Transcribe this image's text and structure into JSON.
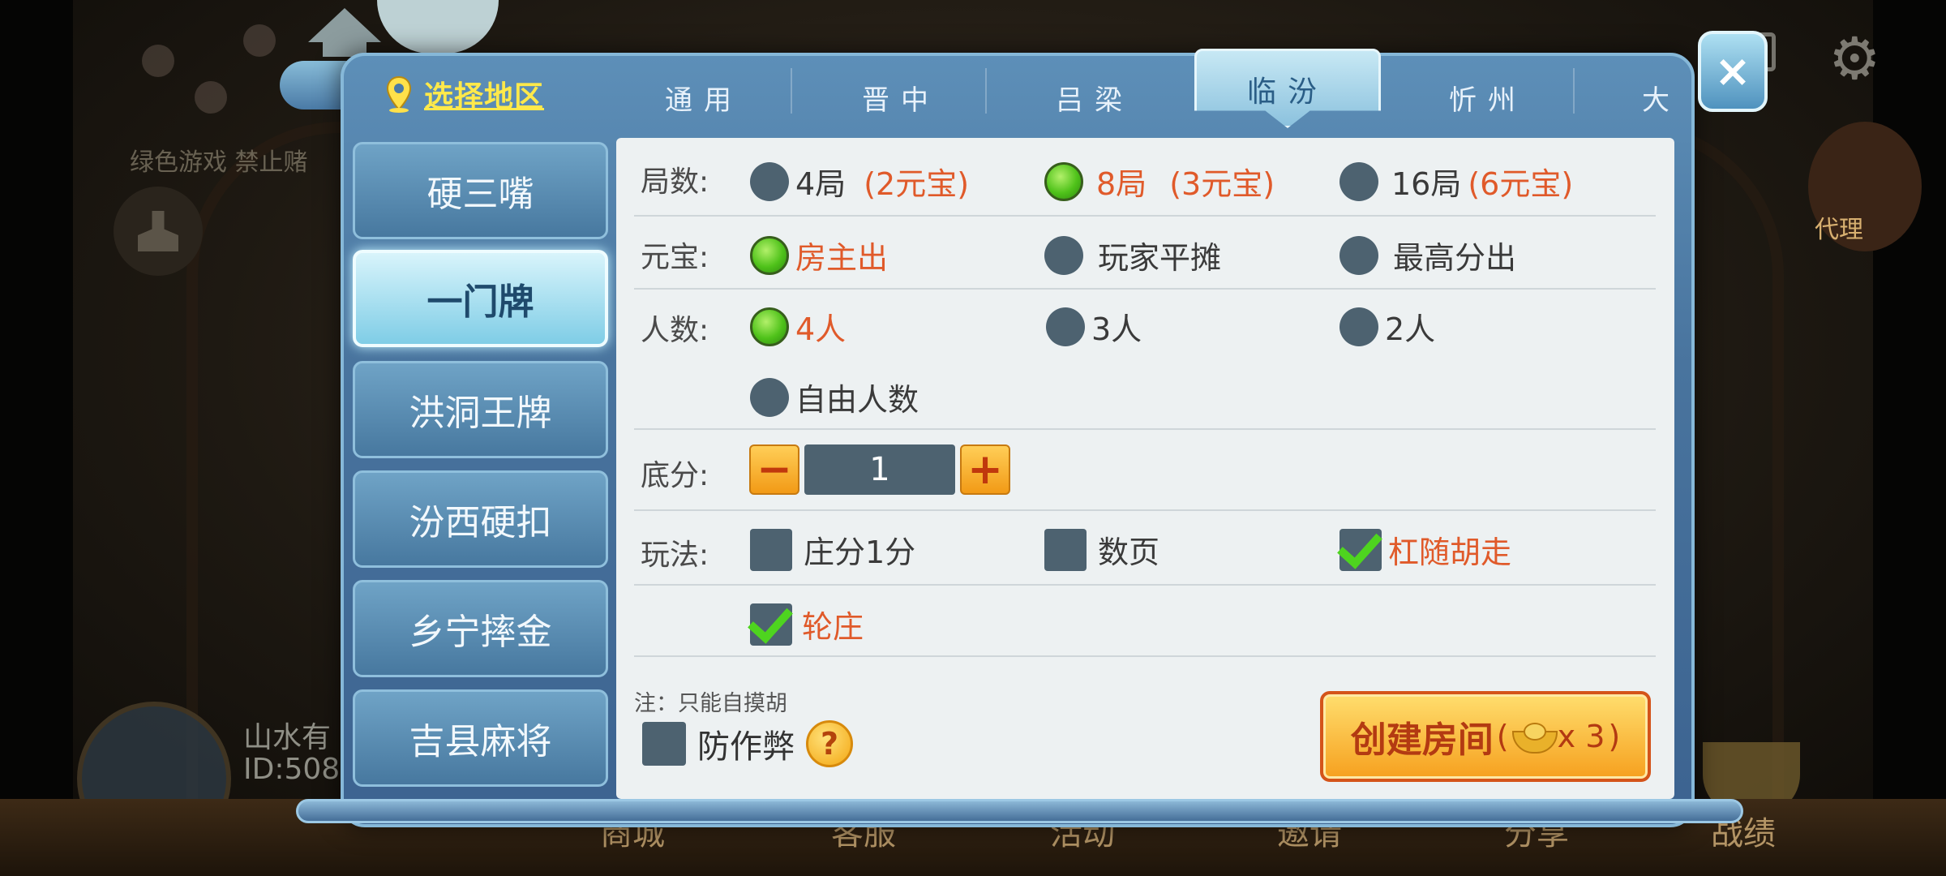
{
  "background": {
    "notice": "绿色游戏 禁止赌",
    "username": "山水有",
    "user_id": "ID:508",
    "agent_label": "代理",
    "bottom_nav": [
      "商城",
      "客服",
      "活动",
      "邀请",
      "分享",
      "战绩"
    ]
  },
  "dialog": {
    "region_label": "选择地区",
    "tabs": [
      "通用",
      "晋中",
      "吕梁",
      "临汾",
      "忻州",
      "大"
    ],
    "active_tab": "临汾",
    "close_label": "×",
    "games": [
      "硬三嘴",
      "一门牌",
      "洪洞王牌",
      "汾西硬扣",
      "乡宁摔金",
      "吉县麻将"
    ],
    "active_game": "一门牌",
    "rounds": {
      "label": "局数:",
      "options": [
        {
          "text": "4局",
          "extra": "(2元宝)",
          "selected": false
        },
        {
          "text": "8局",
          "extra": "(3元宝)",
          "selected": true
        },
        {
          "text": "16局",
          "extra": "(6元宝)",
          "selected": false
        }
      ]
    },
    "ingot": {
      "label": "元宝:",
      "options": [
        {
          "text": "房主出",
          "selected": true
        },
        {
          "text": "玩家平摊",
          "selected": false
        },
        {
          "text": "最高分出",
          "selected": false
        }
      ]
    },
    "players": {
      "label": "人数:",
      "options": [
        {
          "text": "4人",
          "selected": true
        },
        {
          "text": "3人",
          "selected": false
        },
        {
          "text": "2人",
          "selected": false
        },
        {
          "text": "自由人数",
          "selected": false
        }
      ]
    },
    "base_score": {
      "label": "底分:",
      "minus": "−",
      "plus": "+",
      "value": "1"
    },
    "rules": {
      "label": "玩法:",
      "options": [
        {
          "text": "庄分1分",
          "checked": false
        },
        {
          "text": "数页",
          "checked": false
        },
        {
          "text": "杠随胡走",
          "checked": true
        },
        {
          "text": "轮庄",
          "checked": true
        }
      ]
    },
    "note": "注：只能自摸胡",
    "anti_cheat": {
      "text": "防作弊",
      "checked": false,
      "help": "?"
    },
    "create_button": {
      "label": "创建房间",
      "paren_open": "(",
      "count": "x 3",
      "paren_close": ")"
    }
  },
  "colors": {
    "selected_text": "#e05a2a",
    "region_label": "#ffe94a",
    "panel_bg": "#edf1f2",
    "frame": "#49749e"
  }
}
